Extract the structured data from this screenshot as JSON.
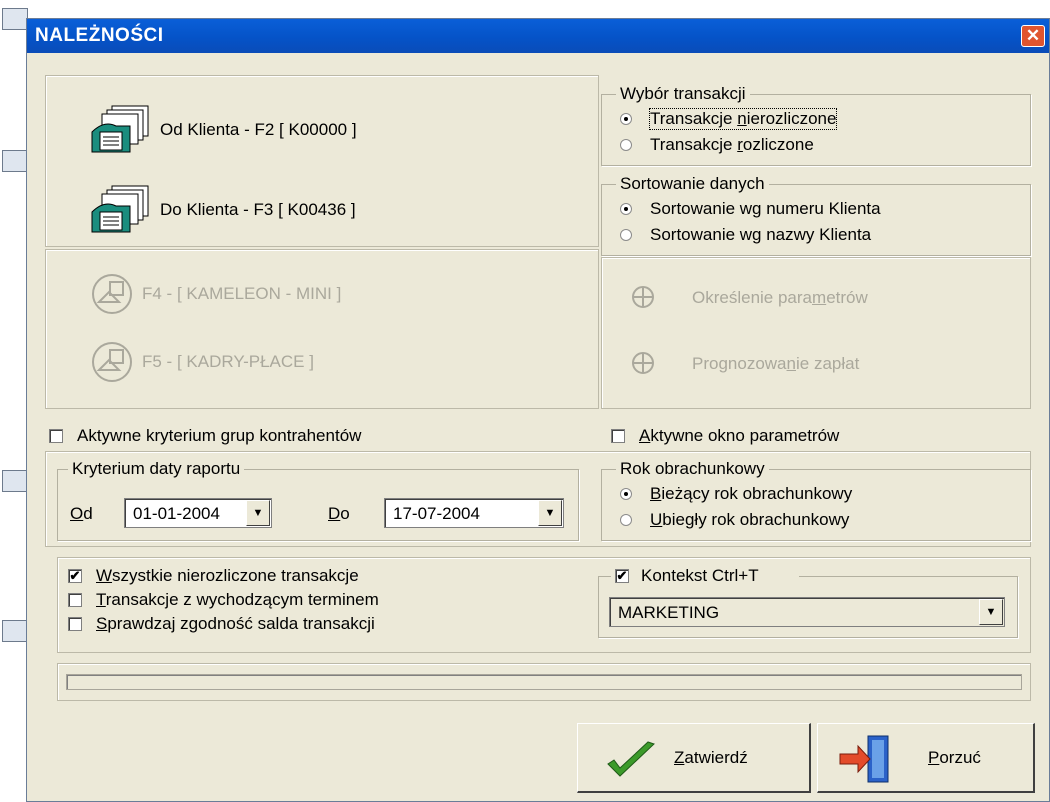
{
  "dialog": {
    "title": "NALEŻNOŚCI"
  },
  "clients": {
    "from": {
      "label": "Od Klienta -  F2 [ K00000 ]"
    },
    "to": {
      "label": "Do Klienta -  F3 [ K00436 ]"
    }
  },
  "modules": [
    {
      "label": "F4 - [ KAMELEON - MINI ]"
    },
    {
      "label": "F5 - [ KADRY-PŁACE ]"
    }
  ],
  "transaction_choice": {
    "title": "Wybór transakcji",
    "options": [
      {
        "pre": "Transakcje ",
        "u": "n",
        "post": "ierozliczone",
        "selected": true
      },
      {
        "pre": "Transakcje ",
        "u": "r",
        "post": "ozliczone",
        "selected": false
      }
    ]
  },
  "sorting": {
    "title": "Sortowanie danych",
    "options": [
      {
        "label": "Sortowanie wg numeru Klienta",
        "selected": true
      },
      {
        "label": "Sortowanie wg nazwy Klienta",
        "selected": false
      }
    ]
  },
  "params": [
    {
      "pre": "Określenie para",
      "u": "m",
      "post": "etrów"
    },
    {
      "pre": "Prognozowa",
      "u": "n",
      "post": "ie zapłat"
    }
  ],
  "group_criteria": {
    "pre": "Aktywne kryterium ",
    "u": "g",
    "post": "rup kontrahentów",
    "checked": false
  },
  "params_window": {
    "pre": "",
    "u": "A",
    "post": "ktywne okno parametrów",
    "checked": false
  },
  "date_criteria": {
    "title": "Kryterium daty raportu",
    "from_u": "O",
    "from_post": "d",
    "from_value": "01-01-2004",
    "to_u": "D",
    "to_post": "o",
    "to_value": "17-07-2004"
  },
  "fiscal_year": {
    "title": "Rok obrachunkowy",
    "options": [
      {
        "u": "B",
        "post": "ieżący rok obrachunkowy",
        "selected": true
      },
      {
        "u": "U",
        "post": "biegły rok obrachunkowy",
        "selected": false
      }
    ]
  },
  "options": [
    {
      "u": "W",
      "post": "szystkie  nierozliczone  transakcje",
      "checked": true
    },
    {
      "u": "T",
      "post": "ransakcje z wychodzącym terminem",
      "checked": false
    },
    {
      "u": "S",
      "post": "prawdzaj zgodność salda transakcji",
      "checked": false
    }
  ],
  "context": {
    "label": "Kontekst Ctrl+T",
    "checked": true,
    "value": "MARKETING"
  },
  "buttons": {
    "ok": {
      "u": "Z",
      "post": "atwierdź"
    },
    "cancel": {
      "u": "P",
      "post": "orzuć"
    }
  },
  "colors": {
    "title_bar": "#0553c8",
    "dialog_bg": "#ece9d8",
    "close_btn": "#e0552f",
    "ok_check": "#3c9a2a"
  }
}
